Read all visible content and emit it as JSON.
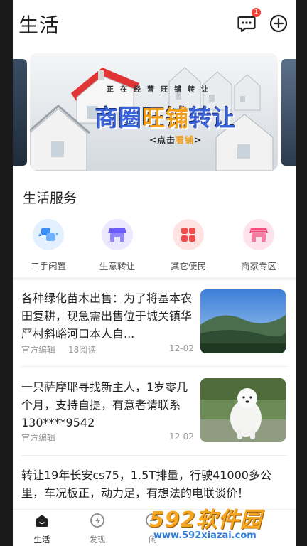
{
  "header": {
    "title": "生活",
    "message_badge": "1"
  },
  "banner": {
    "subtitle": "正在经营旺铺转让",
    "headline_a": "商圈",
    "headline_b": "旺铺",
    "headline_c": "转让",
    "cta_a": "<点击",
    "cta_b": "看铺",
    "cta_c": ">"
  },
  "services": {
    "title": "生活服务",
    "items": [
      {
        "label": "二手闲置",
        "icon": "exchange-icon",
        "color": "#3b8cf3"
      },
      {
        "label": "生意转让",
        "icon": "store-icon",
        "color": "#6b5cf6"
      },
      {
        "label": "其它便民",
        "icon": "grid-icon",
        "color": "#f04b4b"
      },
      {
        "label": "商家专区",
        "icon": "shop-icon",
        "color": "#f24a7a"
      }
    ]
  },
  "news": [
    {
      "text": "各种绿化苗木出售：为了将基本农田复耕，现急需出售位于城关镇华严村斜峪河口本人自...",
      "source": "官方编辑",
      "reads": "18阅读",
      "date": "12-02",
      "thumb": "landscape-photo"
    },
    {
      "text": "一只萨摩耶寻找新主人，1岁零几个月，支持自提，有意者请联系130****9542",
      "source": "官方编辑",
      "reads": "",
      "date": "12-02",
      "thumb": "samoyed-photo"
    },
    {
      "text": "转让19年长安cs75，1.5T排量，行驶41000多公里，车况板正，动力足，有想法的电联谈价！",
      "source": "",
      "reads": "",
      "date": "",
      "thumb": ""
    }
  ],
  "tabbar": {
    "items": [
      {
        "label": "生活",
        "icon": "home-icon",
        "active": true
      },
      {
        "label": "发现",
        "icon": "compass-icon",
        "active": false
      },
      {
        "label": "闲",
        "icon": "idle-icon",
        "active": false
      }
    ]
  },
  "watermark": {
    "brand": "592软件园",
    "url": "www.592xiazai.com"
  },
  "colors": {
    "accent": "#f3a019",
    "primary_text": "#222222",
    "muted_text": "#999999",
    "badge": "#f04134"
  }
}
